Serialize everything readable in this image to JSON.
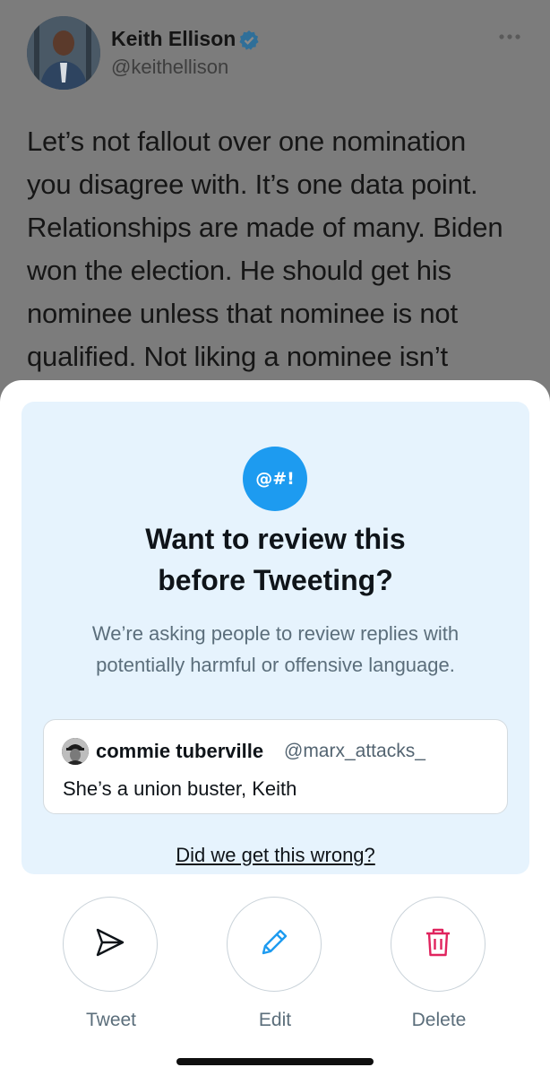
{
  "tweet": {
    "author_name": "Keith Ellison",
    "author_handle": "@keithellison",
    "verified_icon": "verified-badge-icon",
    "more_icon": "more-options-icon",
    "text_lines": [
      "Let’s not fallout over one nomination",
      "you disagree with.  It’s one data point.",
      "Relationships are made of many. Biden",
      "won the election. He should get his",
      "nominee unless that nominee is not",
      "qualified.  Not liking a nominee isn’t"
    ]
  },
  "prompt": {
    "badge_text": "@#!",
    "heading_lines": [
      "Want to review this",
      "before Tweeting?"
    ],
    "subtext_lines": [
      "We’re asking people to review replies with",
      "potentially harmful or offensive language."
    ],
    "reply": {
      "name": "commie tuberville",
      "handle": "@marx_attacks_",
      "text": "She’s a union buster, Keith"
    },
    "feedback_link": "Did we get this wrong?"
  },
  "actions": {
    "tweet_label": "Tweet",
    "edit_label": "Edit",
    "delete_label": "Delete"
  },
  "colors": {
    "accent": "#1d9bf0",
    "delete": "#e0245e",
    "card_bg": "#e6f3fd",
    "overlay": "#7c7c7c"
  }
}
